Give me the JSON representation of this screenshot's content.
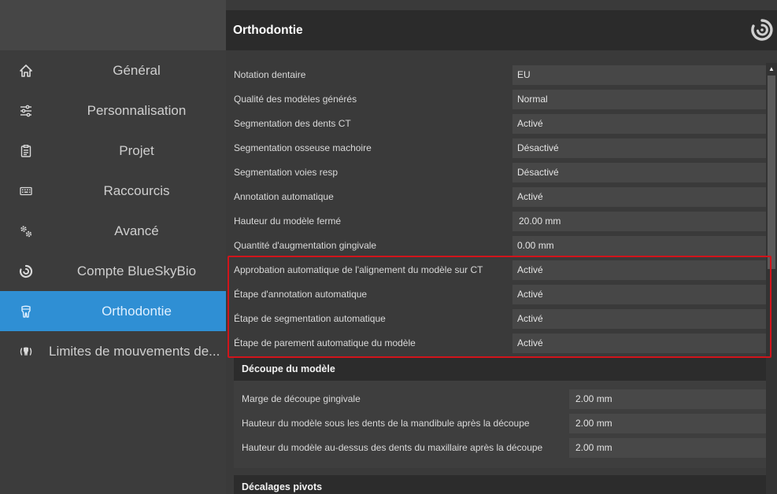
{
  "sidebar": {
    "items": [
      {
        "label": "Général",
        "icon": "home-icon"
      },
      {
        "label": "Personnalisation",
        "icon": "sliders-icon"
      },
      {
        "label": "Projet",
        "icon": "clipboard-icon"
      },
      {
        "label": "Raccourcis",
        "icon": "keyboard-icon"
      },
      {
        "label": "Avancé",
        "icon": "gears-icon"
      },
      {
        "label": "Compte BlueSkyBio",
        "icon": "blueskybio-logo-icon"
      },
      {
        "label": "Orthodontie",
        "icon": "tooth-icon",
        "active": true
      },
      {
        "label": "Limites de mouvements de...",
        "icon": "tooth-movement-icon"
      }
    ]
  },
  "main": {
    "title": "Orthodontie",
    "rows": [
      {
        "label": "Notation dentaire",
        "value": "EU"
      },
      {
        "label": "Qualité des modèles générés",
        "value": "Normal"
      },
      {
        "label": "Segmentation des dents CT",
        "value": "Activé"
      },
      {
        "label": "Segmentation osseuse machoire",
        "value": "Désactivé"
      },
      {
        "label": "Segmentation voies resp",
        "value": "Désactivé"
      },
      {
        "label": "Annotation automatique",
        "value": "Activé"
      },
      {
        "label": "Hauteur du modèle fermé",
        "value": "20.00 mm"
      },
      {
        "label": "Quantité d'augmentation gingivale",
        "value": "0.00 mm"
      },
      {
        "label": "Approbation automatique de l'alignement du modèle sur CT",
        "value": "Activé"
      },
      {
        "label": "Étape d'annotation automatique",
        "value": "Activé"
      },
      {
        "label": "Étape de segmentation automatique",
        "value": "Activé"
      },
      {
        "label": "Étape de parement automatique du modèle",
        "value": "Activé"
      }
    ],
    "section_cut": {
      "title": "Découpe du modèle",
      "rows": [
        {
          "label": "Marge de découpe gingivale",
          "value": "2.00 mm"
        },
        {
          "label": "Hauteur du modèle sous les dents de la mandibule après la découpe",
          "value": "2.00 mm"
        },
        {
          "label": "Hauteur du modèle au-dessus des dents du maxillaire après la découpe",
          "value": "2.00 mm"
        }
      ]
    },
    "section_pivots": {
      "title": "Décalages pivots"
    }
  },
  "colors": {
    "active": "#2f8fd4",
    "highlight": "#d1141b"
  }
}
